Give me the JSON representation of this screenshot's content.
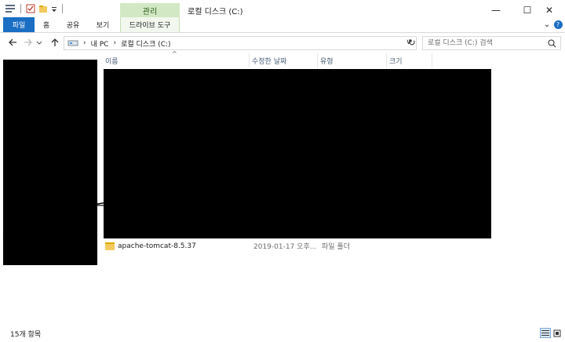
{
  "window": {
    "title": "로컬 디스크 (C:)",
    "context_tab_group": "관리",
    "controls": {
      "minimize": "—",
      "maximize": "☐",
      "close": "✕"
    }
  },
  "ribbon": {
    "tabs": [
      "파일",
      "홈",
      "공유",
      "보기",
      "드라이브 도구"
    ],
    "help_icon": "?",
    "expand_icon": "⌄"
  },
  "address": {
    "breadcrumbs": [
      "내 PC",
      "로컬 디스크 (C:)"
    ],
    "dropdown": "∨",
    "refresh": "↻"
  },
  "search": {
    "placeholder": "로컬 디스크 (C:) 검색"
  },
  "columns": [
    "이름",
    "수정한 날짜",
    "유형",
    "크기"
  ],
  "files": [
    {
      "name": "apache-tomcat-8.5.37",
      "modified": "2019-01-17 오후...",
      "type": "파일 폴더",
      "size": ""
    }
  ],
  "status": {
    "item_count": "15개 항목"
  },
  "colors": {
    "file_tab": "#1a6ec3",
    "context_tab": "#d2e8c4",
    "folder": "#f4c95d"
  }
}
